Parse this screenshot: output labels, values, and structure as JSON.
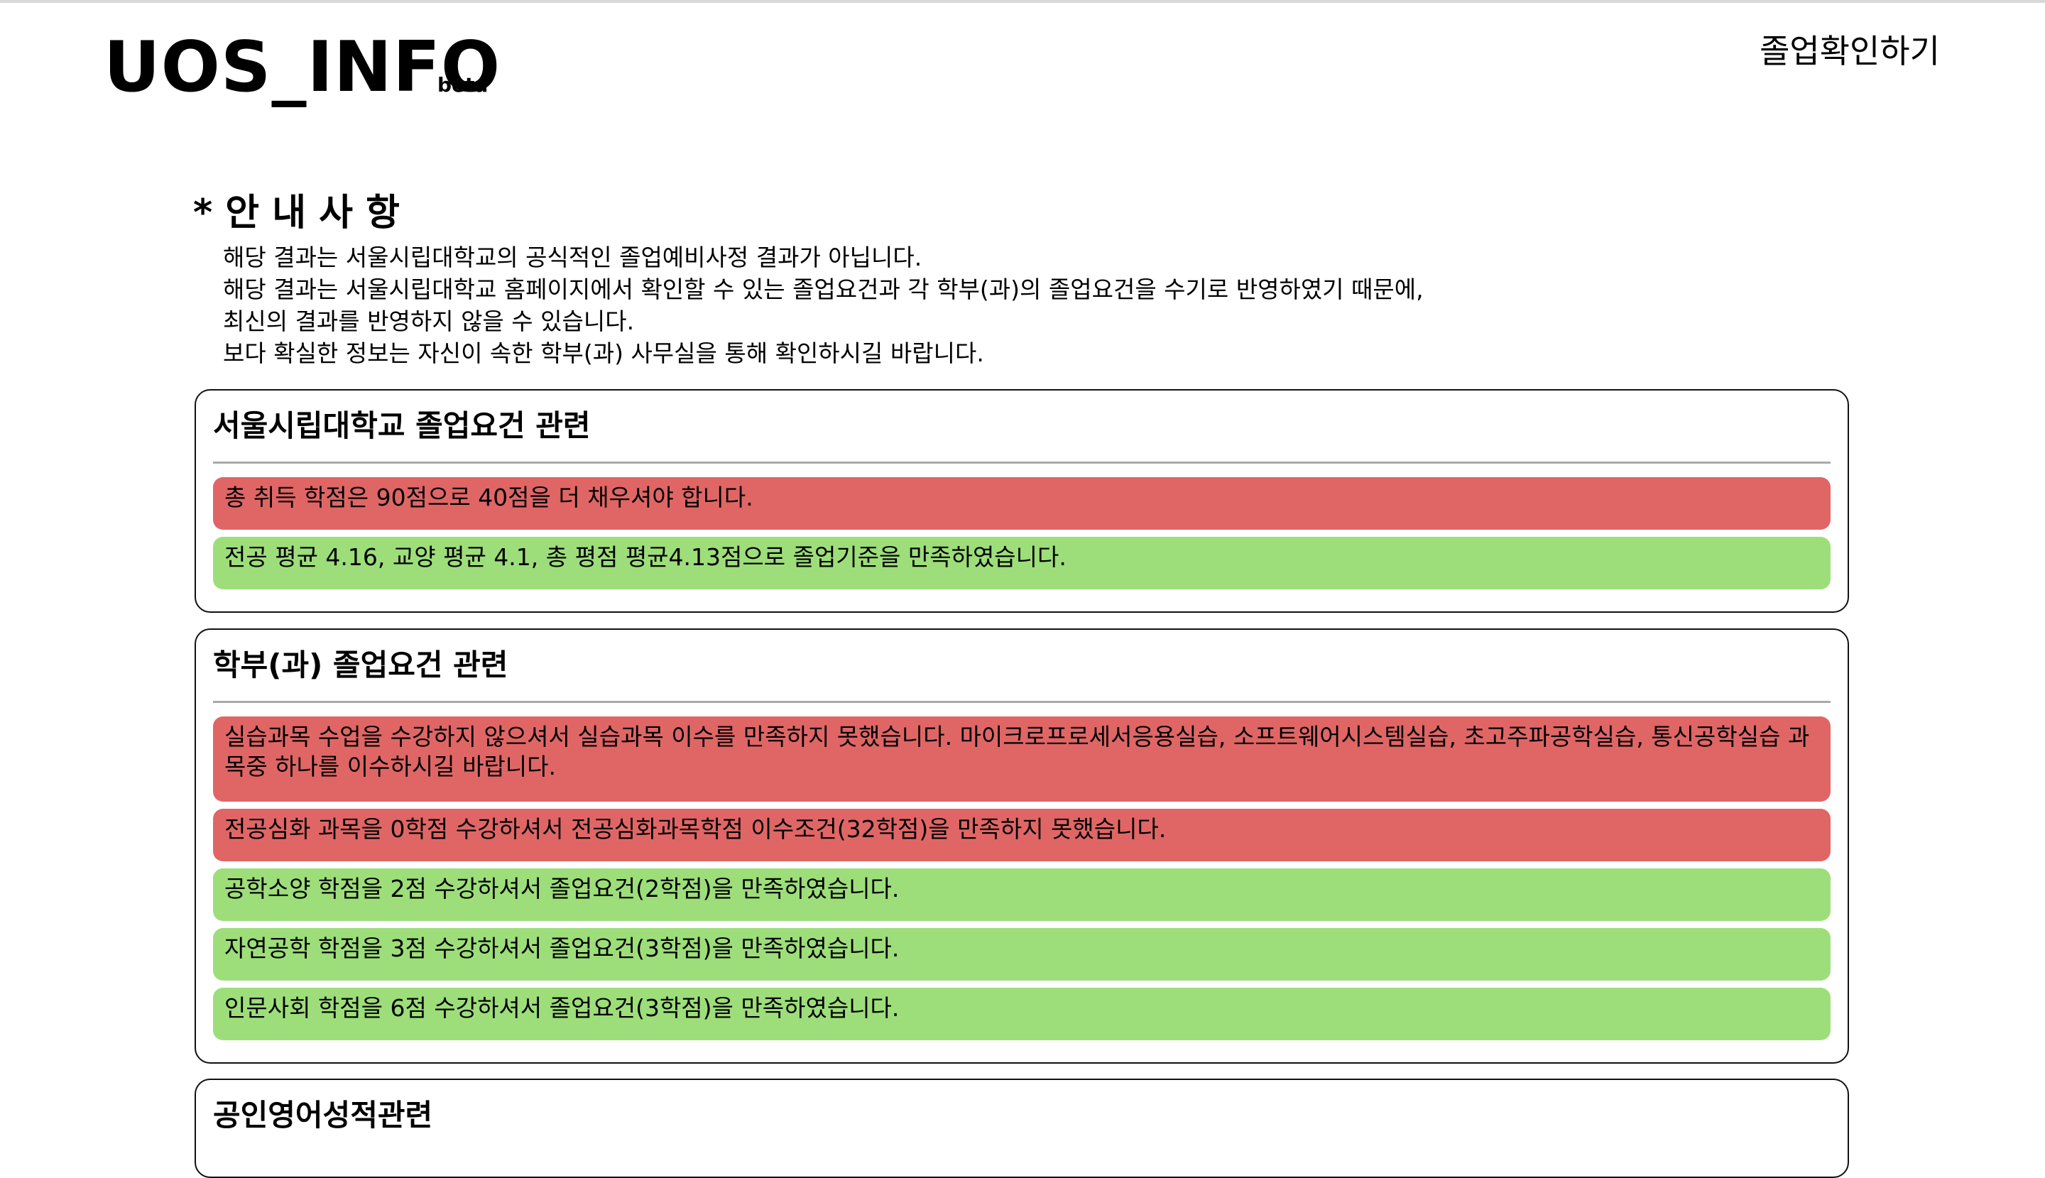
{
  "header": {
    "logo": "UOS_INFO",
    "badge": "beta",
    "nav_link": "졸업확인하기"
  },
  "notice": {
    "title": "* 안 내 사 항",
    "lines": [
      "해당 결과는 서울시립대학교의 공식적인 졸업예비사정 결과가 아닙니다.",
      "해당 결과는 서울시립대학교 홈페이지에서 확인할 수 있는 졸업요건과 각 학부(과)의 졸업요건을 수기로 반영하였기 때문에,",
      "최신의 결과를 반영하지 않을 수 있습니다.",
      "보다 확실한 정보는 자신이 속한 학부(과) 사무실을 통해 확인하시길 바랍니다."
    ]
  },
  "sections": [
    {
      "title": "서울시립대학교 졸업요건 관련",
      "items": [
        {
          "status": "fail",
          "text": "총 취득 학점은 90점으로 40점을 더 채우셔야 합니다."
        },
        {
          "status": "pass",
          "text": "전공 평균 4.16, 교양 평균 4.1, 총 평점 평균4.13점으로 졸업기준을 만족하였습니다."
        }
      ]
    },
    {
      "title": "학부(과) 졸업요건 관련",
      "items": [
        {
          "status": "fail",
          "text": "실습과목 수업을 수강하지 않으셔서 실습과목 이수를 만족하지 못했습니다. 마이크로프로세서응용실습, 소프트웨어시스템실습, 초고주파공학실습, 통신공학실습 과목중 하나를 이수하시길 바랍니다."
        },
        {
          "status": "fail",
          "text": "전공심화 과목을 0학점 수강하셔서 전공심화과목학점 이수조건(32학점)을 만족하지 못했습니다."
        },
        {
          "status": "pass",
          "text": "공학소양 학점을 2점 수강하셔서 졸업요건(2학점)을 만족하였습니다."
        },
        {
          "status": "pass",
          "text": "자연공학 학점을 3점 수강하셔서 졸업요건(3학점)을 만족하였습니다."
        },
        {
          "status": "pass",
          "text": "인문사회 학점을 6점 수강하셔서 졸업요건(3학점)을 만족하였습니다."
        }
      ]
    },
    {
      "title": "공인영어성적관련",
      "items": []
    }
  ],
  "colors": {
    "fail": "#e06666",
    "pass": "#9dde7a",
    "border": "#111111",
    "divider": "#a9a9a9"
  }
}
